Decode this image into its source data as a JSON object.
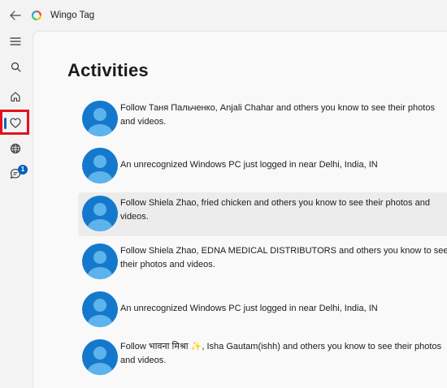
{
  "app": {
    "title": "Wingo Tag",
    "accent_color": "#0067c0"
  },
  "nav": {
    "items": [
      {
        "name": "menu",
        "icon": "hamburger-icon"
      },
      {
        "name": "search",
        "icon": "search-icon"
      },
      {
        "name": "home",
        "icon": "home-icon"
      },
      {
        "name": "activities",
        "icon": "heart-icon",
        "selected": true
      },
      {
        "name": "explore",
        "icon": "globe-icon"
      },
      {
        "name": "messages",
        "icon": "chat-icon",
        "badge": "1"
      }
    ]
  },
  "page": {
    "title": "Activities"
  },
  "activities": [
    {
      "text": "Follow Таня Пальченко, Anjali Chahar and others you know to see their photos and videos."
    },
    {
      "text": "An unrecognized Windows PC just logged in near Delhi, India, IN"
    },
    {
      "text": "Follow Shiela Zhao, fried chicken and others you know to see their photos and videos."
    },
    {
      "text": "Follow Shiela Zhao, EDNA MEDICAL DISTRIBUTORS and others you know to see their photos and videos."
    },
    {
      "text": "An unrecognized Windows PC just logged in near Delhi, India, IN"
    },
    {
      "text": "Follow भावना मिश्रा ✨, Isha Gautam(ishh) and others you know to see their photos and videos."
    }
  ]
}
